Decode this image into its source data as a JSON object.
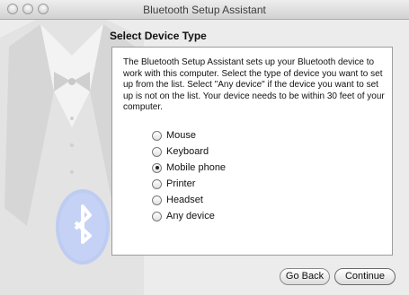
{
  "window": {
    "title": "Bluetooth Setup Assistant"
  },
  "heading": "Select Device Type",
  "description": "The Bluetooth Setup Assistant sets up your Bluetooth device to work with this computer. Select the type of device you want to set up from the list. Select \"Any device\" if the device you want to set up is not on the list. Your device needs to be within 30 feet of your computer.",
  "device_types": [
    {
      "label": "Mouse",
      "selected": false
    },
    {
      "label": "Keyboard",
      "selected": false
    },
    {
      "label": "Mobile phone",
      "selected": true
    },
    {
      "label": "Printer",
      "selected": false
    },
    {
      "label": "Headset",
      "selected": false
    },
    {
      "label": "Any device",
      "selected": false
    }
  ],
  "buttons": {
    "back": "Go Back",
    "continue": "Continue"
  }
}
